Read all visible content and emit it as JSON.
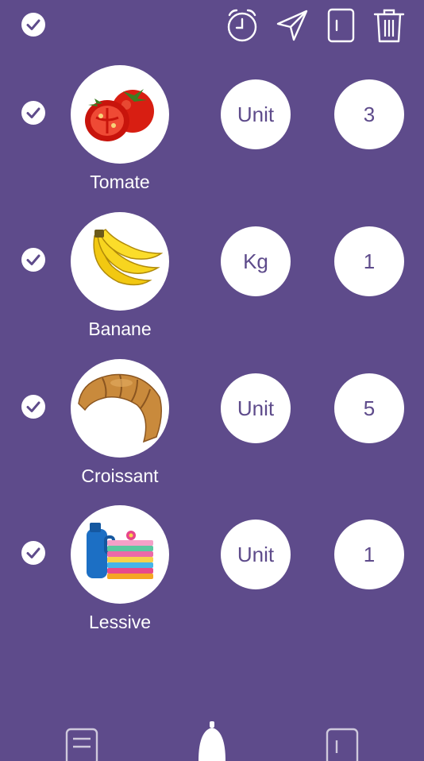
{
  "toolbar": {
    "select_all": "check-circle-icon",
    "icons": [
      "alarm-clock-icon",
      "send-icon",
      "fridge-icon",
      "trash-icon"
    ]
  },
  "items": [
    {
      "name": "Tomate",
      "unit": "Unit",
      "quantity": "3",
      "image": "tomato-image"
    },
    {
      "name": "Banane",
      "unit": "Kg",
      "quantity": "1",
      "image": "banana-image"
    },
    {
      "name": "Croissant",
      "unit": "Unit",
      "quantity": "5",
      "image": "croissant-image"
    },
    {
      "name": "Lessive",
      "unit": "Unit",
      "quantity": "1",
      "image": "laundry-image"
    }
  ],
  "bottom_nav": [
    "list-icon",
    "bell-icon",
    "fridge-icon"
  ],
  "colors": {
    "background": "#5e4b8b",
    "surface": "#ffffff"
  }
}
